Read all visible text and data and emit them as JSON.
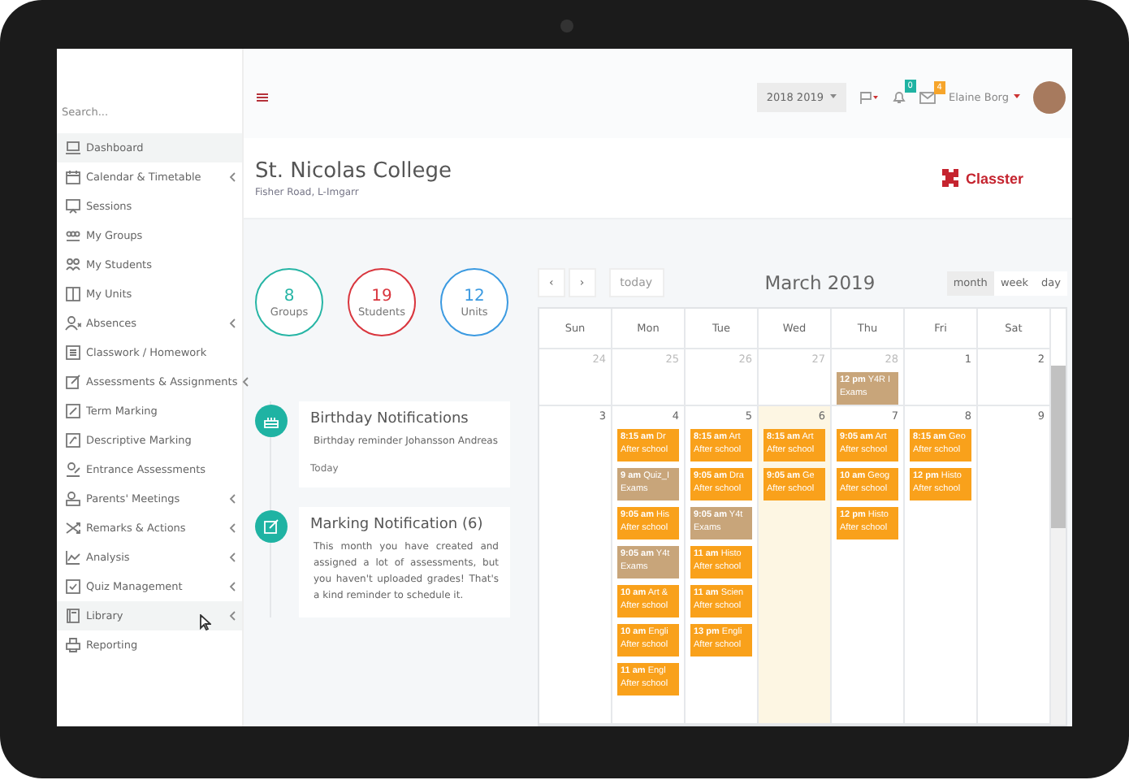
{
  "sidebar": {
    "search": {
      "placeholder": "Search..."
    },
    "items": [
      {
        "label": "Dashboard",
        "has_submenu": false,
        "selected": true
      },
      {
        "label": "Calendar & Timetable",
        "has_submenu": true,
        "selected": false
      },
      {
        "label": "Sessions",
        "has_submenu": false,
        "selected": false
      },
      {
        "label": "My Groups",
        "has_submenu": false,
        "selected": false
      },
      {
        "label": "My Students",
        "has_submenu": false,
        "selected": false
      },
      {
        "label": "My Units",
        "has_submenu": false,
        "selected": false
      },
      {
        "label": "Absences",
        "has_submenu": true,
        "selected": false
      },
      {
        "label": "Classwork / Homework",
        "has_submenu": false,
        "selected": false
      },
      {
        "label": "Assessments & Assignments",
        "has_submenu": true,
        "selected": false
      },
      {
        "label": "Term Marking",
        "has_submenu": false,
        "selected": false
      },
      {
        "label": "Descriptive Marking",
        "has_submenu": false,
        "selected": false
      },
      {
        "label": "Entrance Assessments",
        "has_submenu": false,
        "selected": false
      },
      {
        "label": "Parents' Meetings",
        "has_submenu": true,
        "selected": false
      },
      {
        "label": "Remarks & Actions",
        "has_submenu": true,
        "selected": false
      },
      {
        "label": "Analysis",
        "has_submenu": true,
        "selected": false
      },
      {
        "label": "Quiz Management",
        "has_submenu": true,
        "selected": false
      },
      {
        "label": "Library",
        "has_submenu": true,
        "selected": true
      },
      {
        "label": "Reporting",
        "has_submenu": false,
        "selected": false
      }
    ]
  },
  "topbar": {
    "year": "2018 2019",
    "notifications_badge": "0",
    "messages_badge": "4",
    "user": "Elaine Borg"
  },
  "header": {
    "title": "St. Nicolas College",
    "address": "Fisher Road, L-Imgarr",
    "logo": "Classter"
  },
  "stats": [
    {
      "value": "8",
      "label": "Groups",
      "color": "#26b5a5"
    },
    {
      "value": "19",
      "label": "Students",
      "color": "#d9363e"
    },
    {
      "value": "12",
      "label": "Units",
      "color": "#3b9ae1"
    }
  ],
  "notifications": [
    {
      "kind": "birthday",
      "title": "Birthday Notifications",
      "body": "Birthday reminder Johansson Andreas",
      "time": "Today"
    },
    {
      "kind": "marking",
      "title": "Marking Notification (6)",
      "body": "This month you have created and assigned a lot of assessments, but you haven't uploaded grades! That's a kind reminder to schedule it."
    }
  ],
  "calendar": {
    "prev": "‹",
    "next": "›",
    "today": "today",
    "title": "March 2019",
    "views": [
      {
        "label": "month",
        "selected": true
      },
      {
        "label": "week",
        "selected": false
      },
      {
        "label": "day",
        "selected": false
      }
    ],
    "weekdays": [
      "Sun",
      "Mon",
      "Tue",
      "Wed",
      "Thu",
      "Fri",
      "Sat"
    ],
    "weeks": [
      {
        "days": [
          {
            "date": "24",
            "other_month": true,
            "today": false
          },
          {
            "date": "25",
            "other_month": true,
            "today": false
          },
          {
            "date": "26",
            "other_month": true,
            "today": false
          },
          {
            "date": "27",
            "other_month": true,
            "today": false
          },
          {
            "date": "28",
            "other_month": true,
            "today": false,
            "events": [
              {
                "time": "12 pm",
                "title": "Y4R I",
                "description": "Exams",
                "color": "#c8a57a"
              }
            ]
          },
          {
            "date": "1",
            "other_month": false,
            "today": false
          },
          {
            "date": "2",
            "other_month": false,
            "today": false
          }
        ]
      },
      {
        "days": [
          {
            "date": "3",
            "other_month": false,
            "today": false
          },
          {
            "date": "4",
            "other_month": false,
            "today": false,
            "events": [
              {
                "time": "8:15 am",
                "title": "Dr",
                "description": "After school",
                "color": "#f9a11b"
              },
              {
                "time": "9 am",
                "title": "Quiz_I",
                "description": "Exams",
                "color": "#c8a57a"
              },
              {
                "time": "9:05 am",
                "title": "His",
                "description": "After school",
                "color": "#f9a11b"
              },
              {
                "time": "9:05 am",
                "title": "Y4t",
                "description": "Exams",
                "color": "#c8a57a"
              },
              {
                "time": "10 am",
                "title": "Art &",
                "description": "After school",
                "color": "#f9a11b"
              },
              {
                "time": "10 am",
                "title": "Engli",
                "description": "After school",
                "color": "#f9a11b"
              },
              {
                "time": "11 am",
                "title": "Engl",
                "description": "After school",
                "color": "#f9a11b"
              }
            ]
          },
          {
            "date": "5",
            "other_month": false,
            "today": false,
            "events": [
              {
                "time": "8:15 am",
                "title": "Art",
                "description": "After school",
                "color": "#f9a11b"
              },
              {
                "time": "9:05 am",
                "title": "Dra",
                "description": "After school",
                "color": "#f9a11b"
              },
              {
                "time": "9:05 am",
                "title": "Y4t",
                "description": "Exams",
                "color": "#c8a57a"
              },
              {
                "time": "11 am",
                "title": "Histo",
                "description": "After school",
                "color": "#f9a11b"
              },
              {
                "time": "11 am",
                "title": "Scien",
                "description": "After school",
                "color": "#f9a11b"
              },
              {
                "time": "13 pm",
                "title": "Engli",
                "description": "After school",
                "color": "#f9a11b"
              }
            ]
          },
          {
            "date": "6",
            "other_month": false,
            "today": true,
            "events": [
              {
                "time": "8:15 am",
                "title": "Art",
                "description": "After school",
                "color": "#f9a11b"
              },
              {
                "time": "9:05 am",
                "title": "Ge",
                "description": "After school",
                "color": "#f9a11b"
              }
            ]
          },
          {
            "date": "7",
            "other_month": false,
            "today": false,
            "events": [
              {
                "time": "9:05 am",
                "title": "Art",
                "description": "After school",
                "color": "#f9a11b"
              },
              {
                "time": "10 am",
                "title": "Geog",
                "description": "After school",
                "color": "#f9a11b"
              },
              {
                "time": "12 pm",
                "title": "Histo",
                "description": "After school",
                "color": "#f9a11b"
              }
            ]
          },
          {
            "date": "8",
            "other_month": false,
            "today": false,
            "events": [
              {
                "time": "8:15 am",
                "title": "Geo",
                "description": "After school",
                "color": "#f9a11b"
              },
              {
                "time": "12 pm",
                "title": "Histo",
                "description": "After school",
                "color": "#f9a11b"
              }
            ]
          },
          {
            "date": "9",
            "other_month": false,
            "today": false
          }
        ]
      }
    ]
  }
}
